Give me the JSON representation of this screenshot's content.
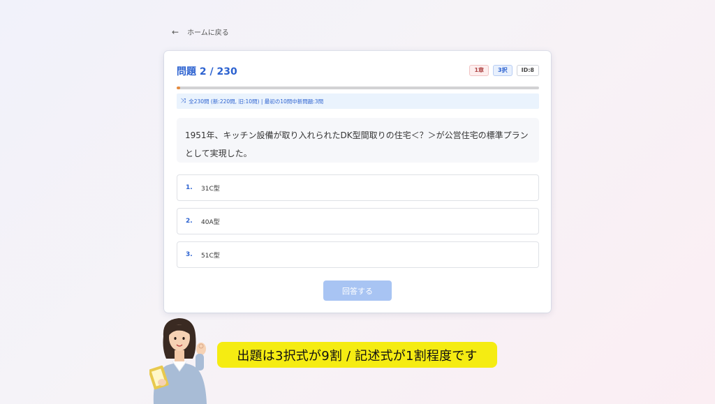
{
  "nav": {
    "back_icon": "←",
    "back_label": "ホームに戻る"
  },
  "quiz": {
    "title": "問題 2 / 230",
    "badges": {
      "chapter": "1章",
      "type": "3択",
      "id": "ID:8"
    },
    "progress_fraction": 0.0087,
    "info_icon": "⤨",
    "info_text": "全230問 (新:220問, 旧:10問) | 最初の10問中新問題:3問",
    "question": "1951年、キッチン設備が取り入れられたDK型間取りの住宅＜？＞が公営住宅の標準プランとして実現した。",
    "options": [
      {
        "num": "1.",
        "text": "31C型"
      },
      {
        "num": "2.",
        "text": "40A型"
      },
      {
        "num": "3.",
        "text": "51C型"
      }
    ],
    "submit_label": "回答する"
  },
  "caption": {
    "text": "出題は3択式が9割 / 記述式が1割程度です"
  },
  "colors": {
    "accent": "#2c62d0",
    "banner": "#f5ec12",
    "progress": "#e58a3c"
  }
}
